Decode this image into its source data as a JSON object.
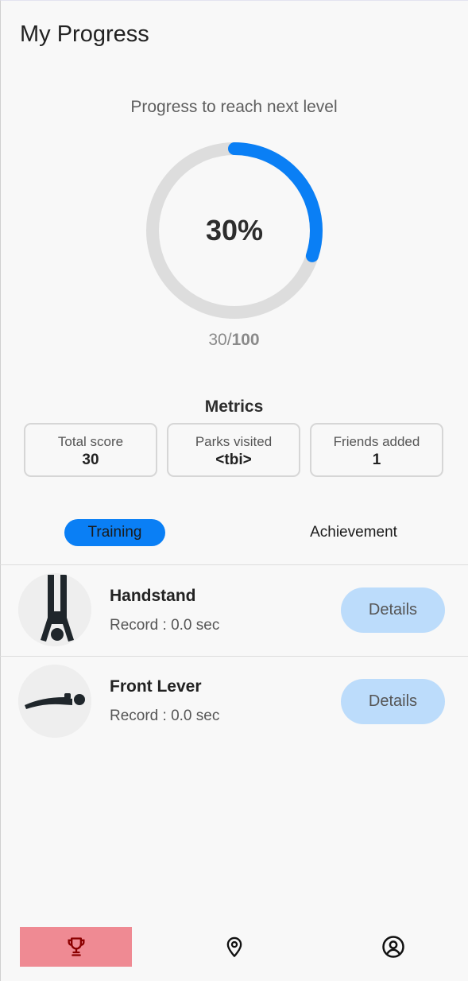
{
  "header": {
    "title": "My Progress"
  },
  "progress": {
    "caption": "Progress to reach next level",
    "percent_label": "30%",
    "fraction": 0.3,
    "current": "30/",
    "target": "100",
    "colors": {
      "track": "#dddddd",
      "fill": "#0a7ff5"
    }
  },
  "metrics": {
    "title": "Metrics",
    "cards": [
      {
        "label": "Total score",
        "value": "30"
      },
      {
        "label": "Parks visited",
        "value": "<tbi>"
      },
      {
        "label": "Friends added",
        "value": "1"
      }
    ]
  },
  "tabs": [
    {
      "label": "Training",
      "selected": true
    },
    {
      "label": "Achievement",
      "selected": false
    }
  ],
  "exercises": [
    {
      "name": "Handstand",
      "record": "Record : 0.0 sec",
      "button": "Details",
      "icon": "handstand-icon"
    },
    {
      "name": "Front Lever",
      "record": "Record : 0.0 sec",
      "button": "Details",
      "icon": "front-lever-icon"
    }
  ],
  "nav": {
    "items": [
      {
        "icon": "trophy-icon",
        "active": true
      },
      {
        "icon": "map-pin-icon",
        "active": false
      },
      {
        "icon": "user-circle-icon",
        "active": false
      }
    ],
    "colors": {
      "active_bg": "#ef8a93",
      "active_icon": "#8b0000",
      "icon": "#111111"
    }
  }
}
